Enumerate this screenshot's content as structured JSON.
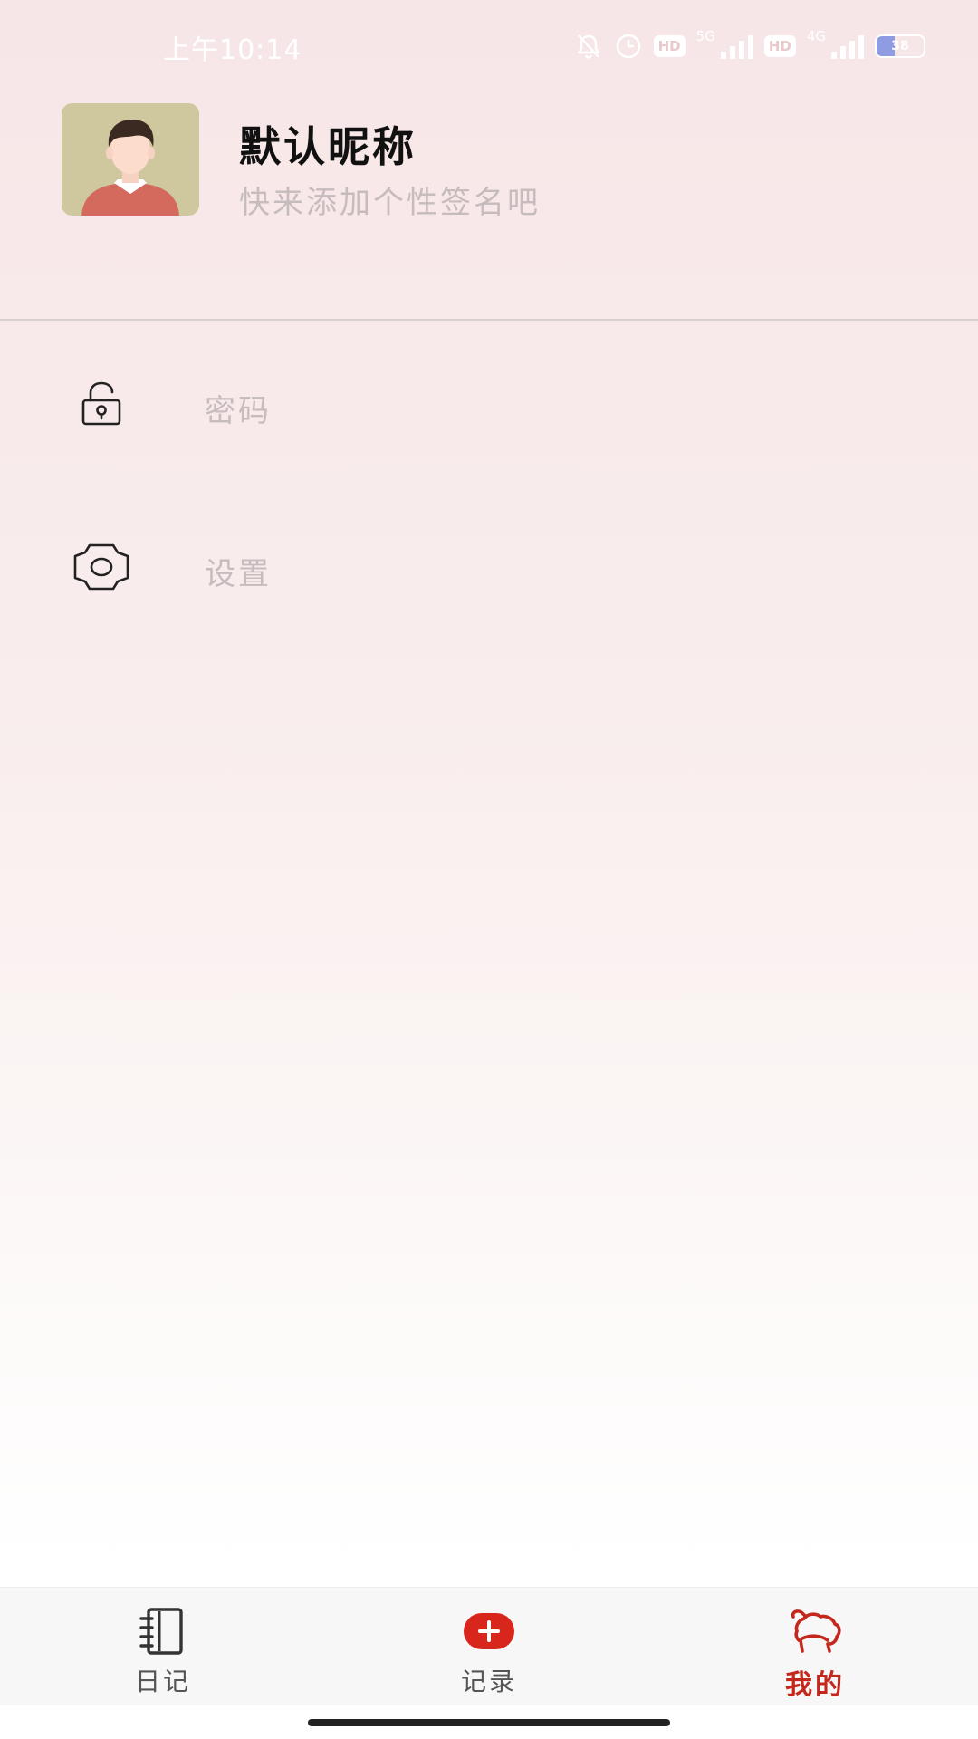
{
  "status_bar": {
    "time": "上午10:14",
    "hd_label_1": "HD",
    "network_1": "5G",
    "hd_label_2": "HD",
    "network_2": "4G",
    "battery": "38",
    "battery_level": 0.38,
    "battery_color": "#7c8ee0",
    "icons": [
      "bell-off-icon",
      "alarm-icon",
      "hd-icon",
      "signal-icon",
      "hd-icon",
      "signal-icon",
      "battery-icon"
    ]
  },
  "profile": {
    "nickname": "默认昵称",
    "signature": "快来添加个性签名吧",
    "avatar_icon": "avatar-man-icon"
  },
  "menu": [
    {
      "id": "password",
      "label": "密码",
      "icon": "unlock-icon"
    },
    {
      "id": "settings",
      "label": "设置",
      "icon": "gear-icon"
    }
  ],
  "bottom_nav": {
    "tabs": [
      {
        "id": "diary",
        "label": "日记",
        "icon": "notebook-icon",
        "active": false
      },
      {
        "id": "record",
        "label": "记录",
        "icon": "plus-icon",
        "active": false
      },
      {
        "id": "mine",
        "label": "我的",
        "icon": "sheep-icon",
        "active": true
      }
    ],
    "active_color": "#c4271c",
    "record_color": "#d9261c"
  }
}
